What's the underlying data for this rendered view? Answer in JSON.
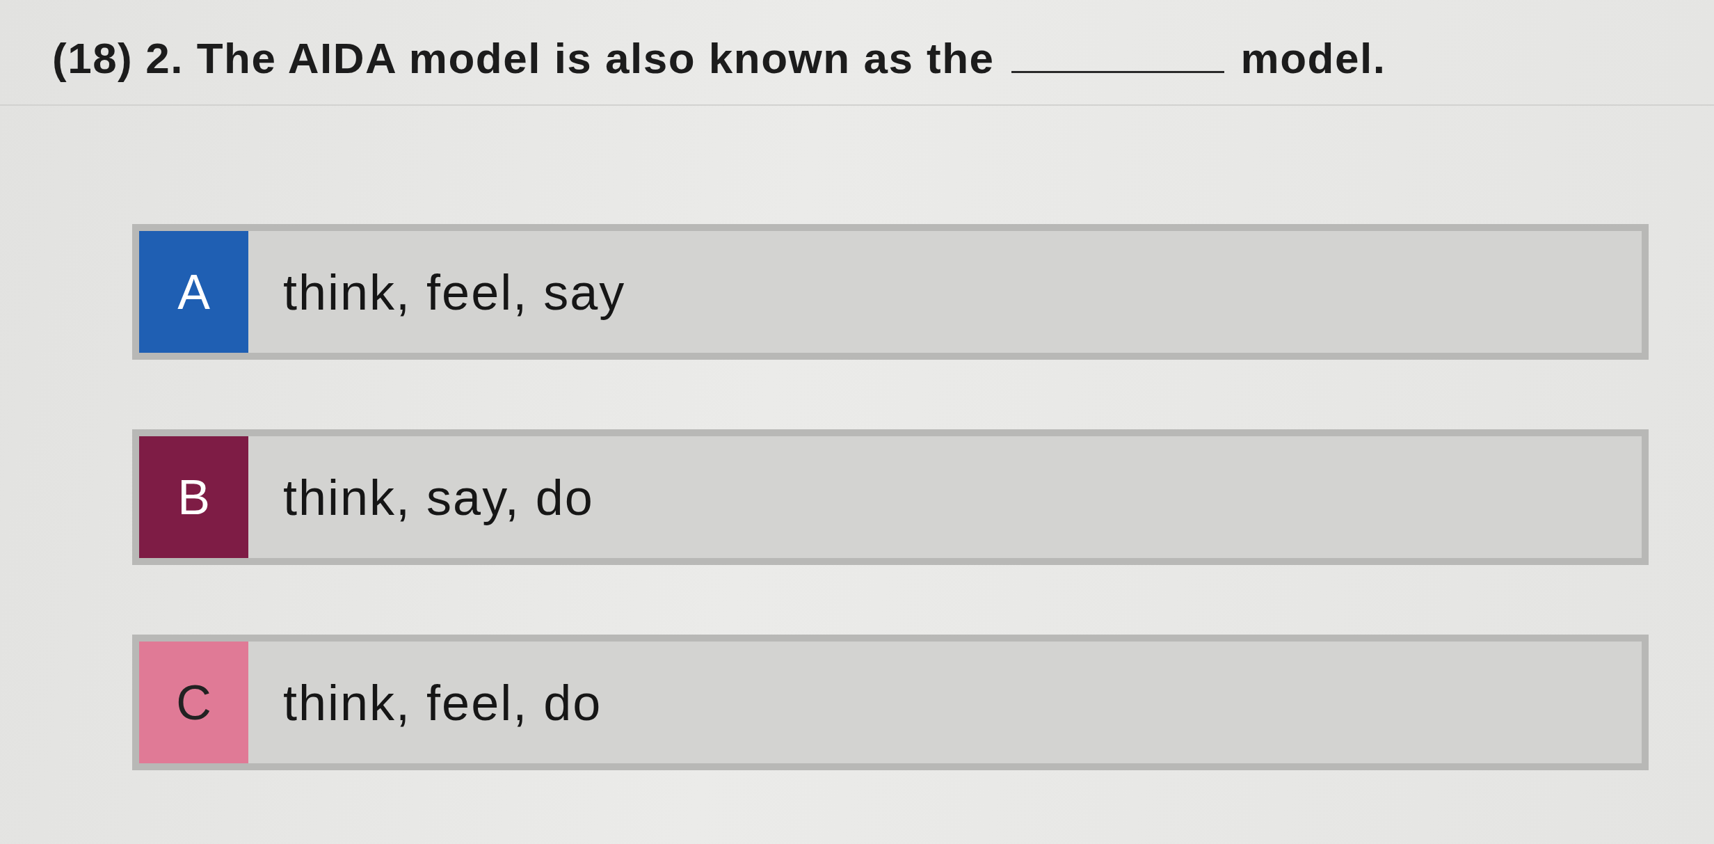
{
  "question": {
    "number": "(18)",
    "before_blank": "2. The AIDA model is also known as the",
    "after_blank": "model."
  },
  "options": [
    {
      "letter": "A",
      "text": "think, feel, say",
      "color": "#1f5fb3",
      "selected": false
    },
    {
      "letter": "B",
      "text": "think, say, do",
      "color": "#7e1c45",
      "selected": false
    },
    {
      "letter": "C",
      "text": "think, feel, do",
      "color": "#e07a96",
      "selected": false
    }
  ]
}
